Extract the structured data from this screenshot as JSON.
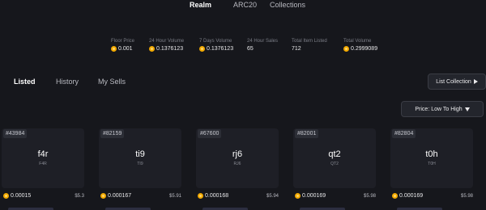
{
  "nav": {
    "tabs": [
      {
        "label": "Realm",
        "active": true
      },
      {
        "label": "ARC20",
        "active": false
      },
      {
        "label": "Collections",
        "active": false
      }
    ]
  },
  "stats": [
    {
      "label": "Floor Price",
      "value": "0.001",
      "icon": "coin-icon"
    },
    {
      "label": "24 Hour Volume",
      "value": "0.1376123",
      "icon": "coin-icon"
    },
    {
      "label": "7 Days Volume",
      "value": "0.1376123",
      "icon": "coin-icon"
    },
    {
      "label": "24 Hour Sales",
      "value": "65"
    },
    {
      "label": "Total Item Listed",
      "value": "712"
    },
    {
      "label": "Total Volume",
      "value": "0.2999089",
      "icon": "coin-icon"
    }
  ],
  "subtabs": [
    {
      "label": "Listed",
      "active": true
    },
    {
      "label": "History",
      "active": false
    },
    {
      "label": "My Sells",
      "active": false
    }
  ],
  "buttons": {
    "list_collection": "List Collection",
    "sort": "Price: Low To High"
  },
  "cards": [
    {
      "id": "#43984",
      "name": "f4r",
      "ticker": "F4R",
      "price": "0.00015",
      "usd": "$5.3"
    },
    {
      "id": "#82159",
      "name": "ti9",
      "ticker": "TI9",
      "price": "0.000167",
      "usd": "$5.91"
    },
    {
      "id": "#67600",
      "name": "rj6",
      "ticker": "RJ6",
      "price": "0.000168",
      "usd": "$5.94"
    },
    {
      "id": "#82001",
      "name": "qt2",
      "ticker": "QT2",
      "price": "0.000169",
      "usd": "$5.98"
    },
    {
      "id": "#82804",
      "name": "t0h",
      "ticker": "T0H",
      "price": "0.000169",
      "usd": "$5.98"
    }
  ],
  "colors": {
    "background": "#16171c",
    "card": "#1e1f26",
    "coin": "#f2a900"
  }
}
